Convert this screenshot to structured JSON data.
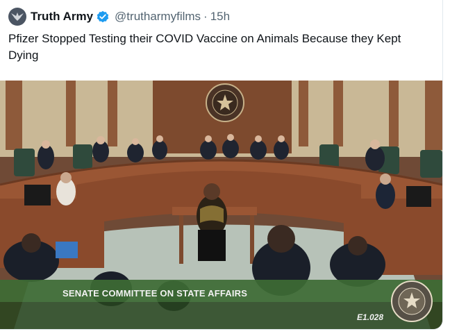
{
  "tweet": {
    "author_name": "Truth Army",
    "handle": "@trutharmyfilms",
    "separator": "·",
    "time": "15h",
    "text": "Pfizer Stopped Testing their COVID Vaccine on Animals Because they Kept Dying"
  },
  "video": {
    "lower_third": "SENATE COMMITTEE ON STATE AFFAIRS",
    "episode_code": "E1.028"
  },
  "colors": {
    "verified_blue": "#1d9bf0",
    "wood": "#8a4a2c",
    "banner_green": "#3d6b34"
  }
}
